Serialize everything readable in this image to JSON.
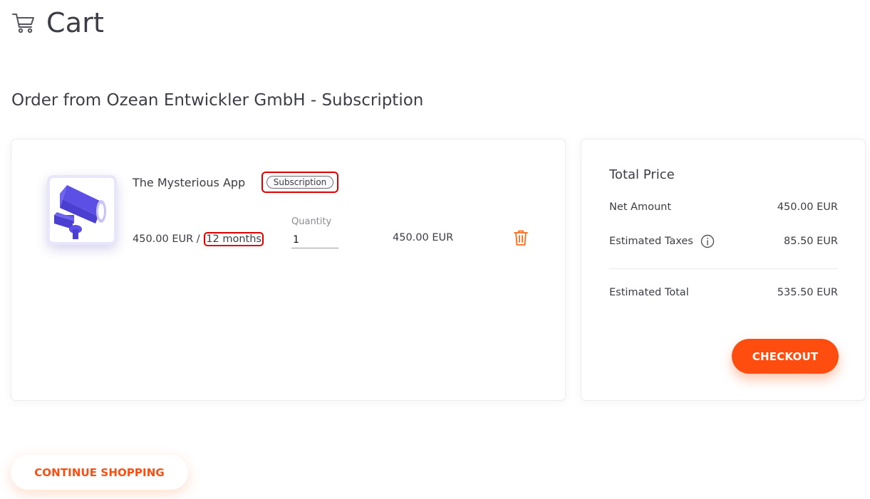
{
  "header": {
    "title": "Cart",
    "icon": "shopping-cart-icon"
  },
  "order": {
    "title": "Order from Ozean Entwickler GmbH - Subscription"
  },
  "item": {
    "image_icon": "security-camera-icon",
    "name": "The Mysterious App",
    "badge": "Subscription",
    "price": "450.00 EUR /",
    "period": "12 months",
    "quantity_label": "Quantity",
    "quantity": "1",
    "line_total": "450.00 EUR",
    "delete_icon": "trash-icon"
  },
  "summary": {
    "title": "Total Price",
    "net_label": "Net Amount",
    "net_value": "450.00 EUR",
    "taxes_label": "Estimated Taxes",
    "taxes_info_icon": "info-icon",
    "taxes_value": "85.50 EUR",
    "total_label": "Estimated Total",
    "total_value": "535.50 EUR",
    "checkout_label": "CHECKOUT"
  },
  "footer": {
    "continue_label": "CONTINUE SHOPPING"
  },
  "colors": {
    "accent": "#ff4d0f",
    "highlight": "#e10000",
    "product_icon": "#5b4fe6"
  }
}
